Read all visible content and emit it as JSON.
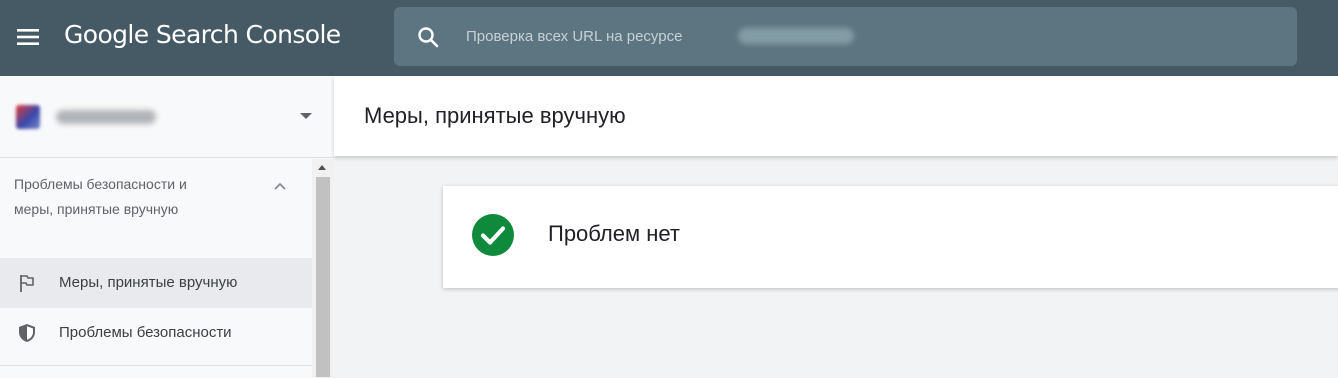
{
  "app": {
    "title": "Google Search Console"
  },
  "header": {
    "menu_icon": "hamburger-menu-icon",
    "search": {
      "icon": "search-icon",
      "placeholder": "Проверка всех URL на ресурсе"
    }
  },
  "sidebar": {
    "property": {
      "name_blurred": true,
      "icon": "chevron-down-icon"
    },
    "section": {
      "title": "Проблемы безопасности и меры, принятые вручную",
      "expanded": true
    },
    "items": [
      {
        "label": "Меры, принятые вручную",
        "icon": "flag-icon",
        "active": true
      },
      {
        "label": "Проблемы безопасности",
        "icon": "shield-icon",
        "active": false
      }
    ]
  },
  "main": {
    "title": "Меры, принятые вручную",
    "status_card": {
      "icon": "check-circle-icon",
      "text": "Проблем нет"
    }
  },
  "colors": {
    "topbar": "#455a64",
    "search_bg": "#5d7580",
    "success_green": "#0f8a3c",
    "active_item_bg": "#e8eaed"
  }
}
